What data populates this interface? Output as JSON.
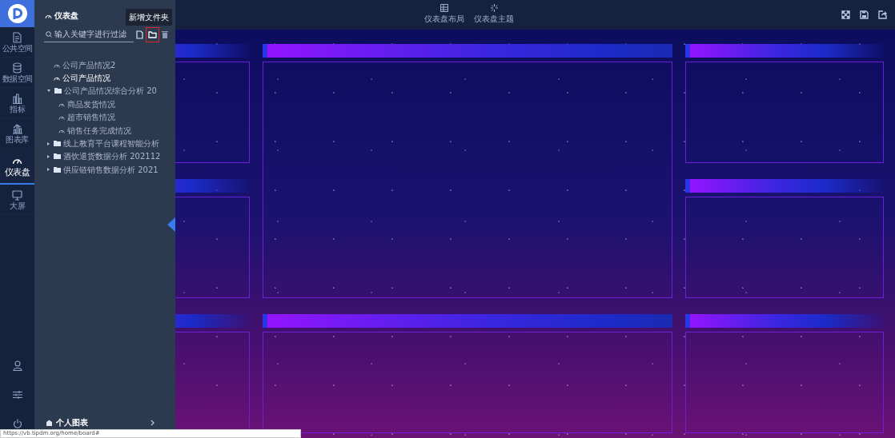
{
  "rail": {
    "items": [
      {
        "label": "公共空间",
        "selected": false
      },
      {
        "label": "数据空间",
        "selected": false
      },
      {
        "label": "指标",
        "selected": false
      },
      {
        "label": "图表库",
        "selected": false
      },
      {
        "label": "仪表盘",
        "selected": true
      },
      {
        "label": "大屏",
        "selected": false
      }
    ]
  },
  "drawer": {
    "title": "仪表盘",
    "search": {
      "placeholder": "输入关键字进行过滤"
    },
    "tooltip": "新增文件夹",
    "tree": [
      {
        "kind": "dashboard",
        "label": "公司产品情况2",
        "selected": false
      },
      {
        "kind": "dashboard",
        "label": "公司产品情况",
        "selected": true
      },
      {
        "kind": "folder",
        "label": "公司产品情况综合分析 20",
        "expanded": true,
        "selected": false,
        "children": [
          {
            "kind": "dashboard",
            "label": "商品发货情况",
            "selected": false
          },
          {
            "kind": "dashboard",
            "label": "超市销售情况",
            "selected": false
          },
          {
            "kind": "dashboard",
            "label": "销售任务完成情况",
            "selected": false
          }
        ]
      },
      {
        "kind": "folder",
        "label": "线上教育平台课程智能分析",
        "expanded": false,
        "selected": false
      },
      {
        "kind": "folder",
        "label": "酒饮退货数据分析 202112",
        "expanded": false,
        "selected": false
      },
      {
        "kind": "folder",
        "label": "供应链销售数据分析 2021",
        "expanded": false,
        "selected": false
      }
    ],
    "footer": "个人图表"
  },
  "toolbar": {
    "items": [
      {
        "label": "仪表盘布局"
      },
      {
        "label": "仪表盘主题"
      }
    ]
  },
  "status_url": "https://vb.tipdm.org/home/board#"
}
